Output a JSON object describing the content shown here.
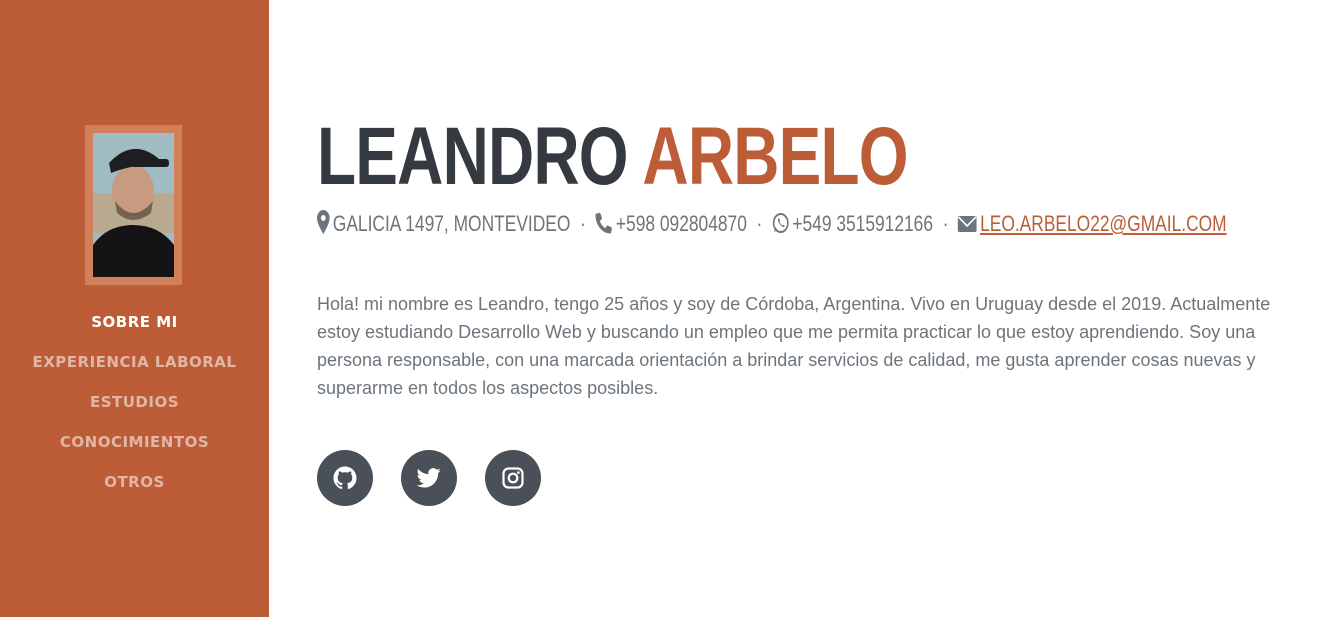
{
  "sidebar": {
    "avatar_alt": "Leandro Arbelo",
    "nav": [
      {
        "label": "SOBRE MI",
        "active": true
      },
      {
        "label": "EXPERIENCIA LABORAL",
        "active": false
      },
      {
        "label": "ESTUDIOS",
        "active": false
      },
      {
        "label": "CONOCIMIENTOS",
        "active": false
      },
      {
        "label": "OTROS",
        "active": false
      }
    ]
  },
  "header": {
    "first_name": "LEANDRO",
    "last_name": "ARBELO"
  },
  "contact": {
    "address": "GALICIA 1497, MONTEVIDEO",
    "phone": "+598 092804870",
    "whatsapp": "+549 3515912166",
    "email": "LEO.ARBELO22@GMAIL.COM",
    "separator": "·",
    "icons": [
      "map-marker-icon",
      "phone-icon",
      "whatsapp-icon",
      "envelope-icon"
    ]
  },
  "bio": "Hola! mi nombre es Leandro, tengo 25 años y soy de Córdoba, Argentina. Vivo en Uruguay desde el 2019. Actualmente estoy estudiando Desarrollo Web y buscando un empleo que me permita practicar lo que estoy aprendiendo. Soy una persona responsable, con una marcada orientación a brindar servicios de calidad, me gusta aprender cosas nuevas y superarme en todos los aspectos posibles.",
  "social": [
    {
      "icon": "github-icon"
    },
    {
      "icon": "twitter-icon"
    },
    {
      "icon": "instagram-icon"
    }
  ],
  "colors": {
    "primary": "#bd5d38",
    "dark": "#343a40",
    "muted": "#6c757d",
    "social_bg": "#495057"
  }
}
